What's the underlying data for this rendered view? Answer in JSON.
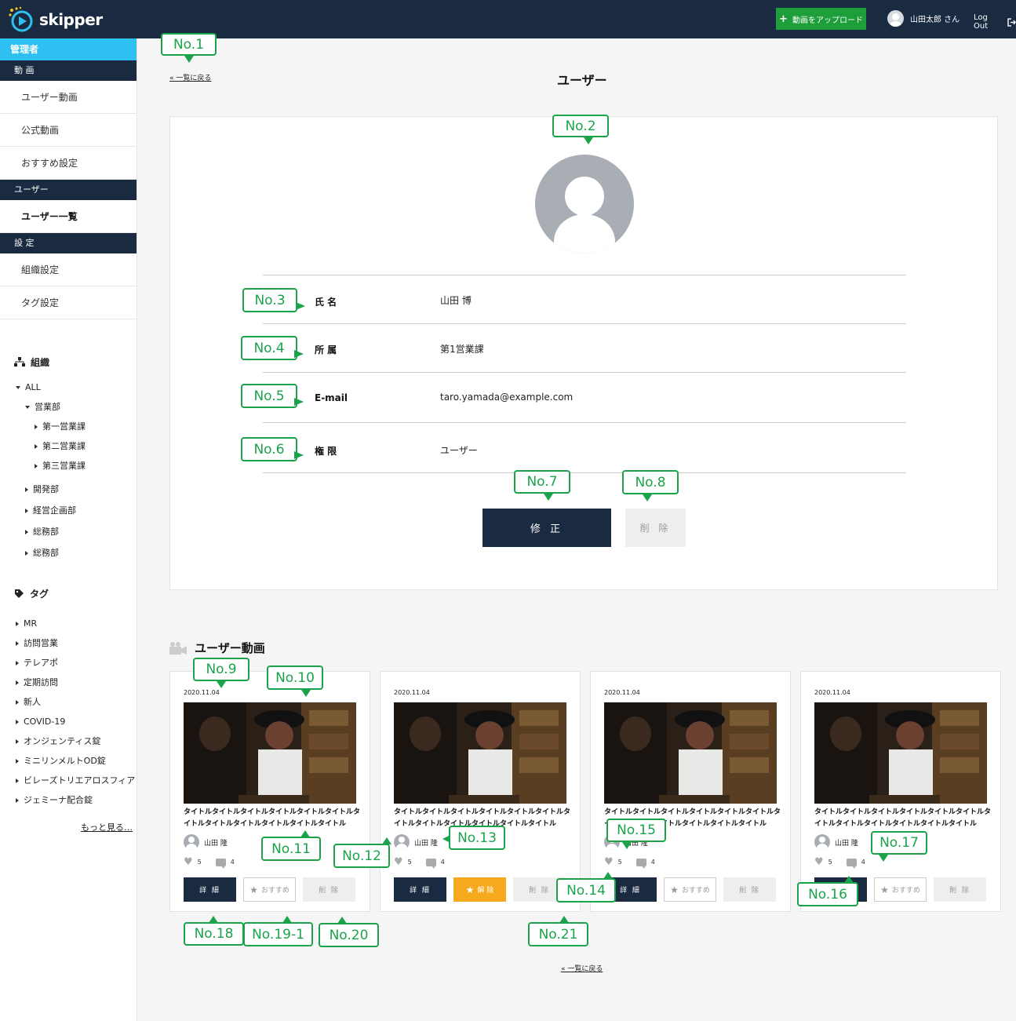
{
  "header": {
    "logo_text": "skipper",
    "upload_label": "動画をアップロード",
    "user_name": "山田太郎 さん",
    "logout_label": "Log Out"
  },
  "sidebar": {
    "admin_label": "管理者",
    "sections": [
      {
        "title": "動 画",
        "items": [
          "ユーザー動画",
          "公式動画",
          "おすすめ設定"
        ]
      },
      {
        "title": "ユーザー",
        "items": [
          "ユーザー一覧"
        ]
      },
      {
        "title": "設 定",
        "items": [
          "組織設定",
          "タグ設定"
        ]
      }
    ],
    "org_title": "組織",
    "org_tree": [
      "ALL",
      "営業部",
      "第一営業課",
      "第二営業課",
      "第三営業課",
      "開発部",
      "経営企画部",
      "総務部",
      "総務部"
    ],
    "tag_title": "タグ",
    "tags": [
      "MR",
      "訪問営業",
      "テレアポ",
      "定期訪問",
      "新人",
      "COVID-19",
      "オンジェンティス錠",
      "ミニリンメルトOD錠",
      "ビレーズトリエアロスフィア",
      "ジェミーナ配合錠"
    ],
    "more_label": "もっと見る…"
  },
  "main": {
    "back_label": "« 一覧に戻る",
    "title": "ユーザー",
    "fields": [
      {
        "label": "氏 名",
        "value": "山田 博"
      },
      {
        "label": "所 属",
        "value": "第1営業課"
      },
      {
        "label": "E-mail",
        "value": "taro.yamada@example.com"
      },
      {
        "label": "権 限",
        "value": "ユーザー"
      }
    ],
    "edit_label": "修 正",
    "delete_label": "削 除",
    "videos_title": "ユーザー動画",
    "videos": [
      {
        "date": "2020.11.04",
        "title": "タイトルタイトルタイトルタイトルタイトルタイトルタイトルタイトルタイトルタイトルタイトルタイトル",
        "owner": "山田 隆",
        "likes": "5",
        "comments": "4",
        "detail": "詳 細",
        "rec": "おすすめ",
        "rec_on": false,
        "del": "削 除"
      },
      {
        "date": "2020.11.04",
        "title": "タイトルタイトルタイトルタイトルタイトルタイトルタイトルタイトルタイトルタイトルタイトルタイトル",
        "owner": "山田 隆",
        "likes": "5",
        "comments": "4",
        "detail": "詳 細",
        "rec": "解 除",
        "rec_on": true,
        "del": "削 除"
      },
      {
        "date": "2020.11.04",
        "title": "タイトルタイトルタイトルタイトルタイトルタイトルタイトルタイトルタイトルタイトルタイトルタイトル",
        "owner": "山田 隆",
        "likes": "5",
        "comments": "4",
        "detail": "詳 細",
        "rec": "おすすめ",
        "rec_on": false,
        "del": "削 除"
      },
      {
        "date": "2020.11.04",
        "title": "タイトルタイトルタイトルタイトルタイトルタイトルタイトルタイトルタイトルタイトルタイトルタイトル",
        "owner": "山田 隆",
        "likes": "5",
        "comments": "4",
        "detail": "詳 細",
        "rec": "おすすめ",
        "rec_on": false,
        "del": "削 除"
      }
    ],
    "bottom_back_label": "« 一覧に戻る"
  },
  "callouts": [
    "No.1",
    "No.2",
    "No.3",
    "No.4",
    "No.5",
    "No.6",
    "No.7",
    "No.8",
    "No.9",
    "No.10",
    "No.11",
    "No.12",
    "No.13",
    "No.14",
    "No.15",
    "No.16",
    "No.17",
    "No.18",
    "No.19-1",
    "No.20",
    "No.21"
  ],
  "colors": {
    "header_bg": "#1a2a40",
    "accent_blue": "#2ec0f0",
    "upload_green": "#1e9e3a",
    "callout_green": "#1aa34a",
    "rec_orange": "#f7a91e"
  }
}
